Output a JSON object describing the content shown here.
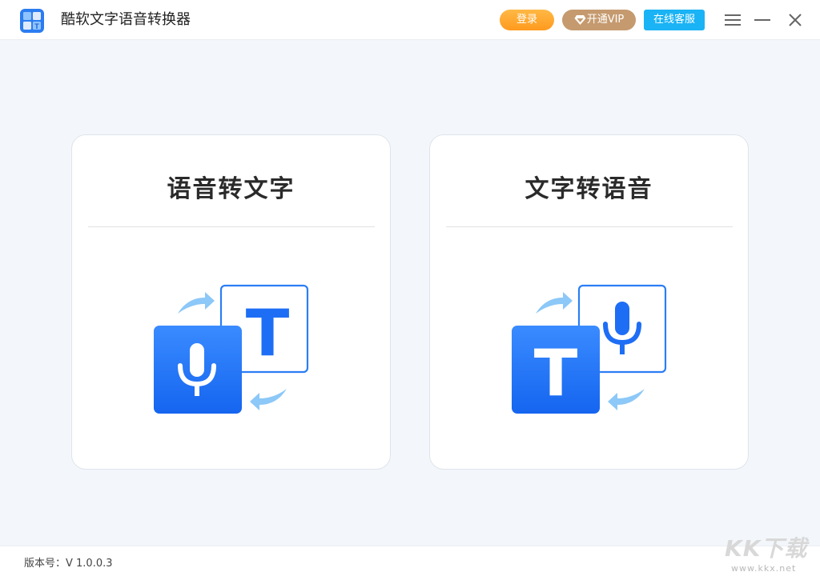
{
  "app": {
    "title": "酷软文字语音转换器",
    "logo_icon": "app-logo-icon"
  },
  "header": {
    "login_label": "登录",
    "vip_label": "开通VIP",
    "service_label": "在线客服",
    "menu_icon": "hamburger-menu-icon",
    "minimize_icon": "minimize-icon",
    "close_icon": "close-icon"
  },
  "cards": [
    {
      "title": "语音转文字",
      "icon": "speech-to-text-icon"
    },
    {
      "title": "文字转语音",
      "icon": "text-to-speech-icon"
    }
  ],
  "footer": {
    "version": "版本号：V 1.0.0.3"
  },
  "watermark": {
    "brand": "KK下载",
    "url": "www.kkx.net"
  },
  "colors": {
    "accent_blue": "#1e6ef5",
    "login_orange": "#ffa42f",
    "vip_gold": "#c59a6e",
    "service_blue": "#1ab3f5"
  }
}
